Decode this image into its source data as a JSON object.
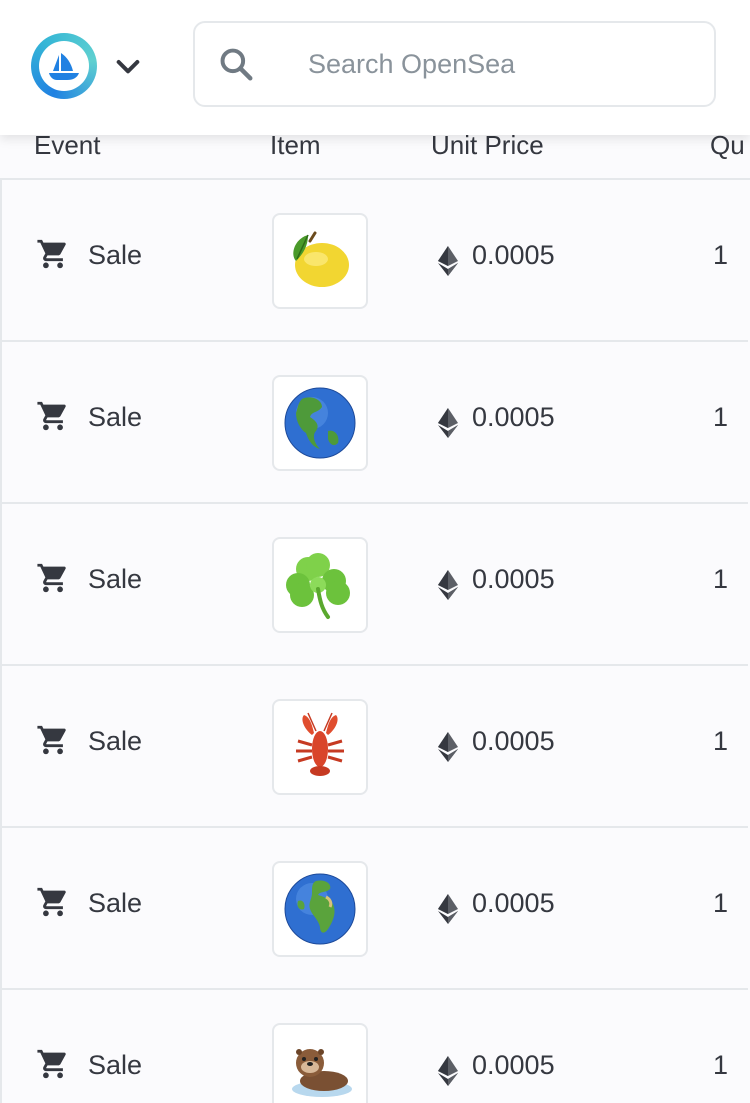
{
  "search": {
    "placeholder": "Search OpenSea"
  },
  "table": {
    "columns": [
      "Event",
      "Item",
      "Unit Price",
      "Qu"
    ],
    "rows": [
      {
        "event": "Sale",
        "item_icon": "lemon-icon",
        "price": "0.0005",
        "quantity": "1"
      },
      {
        "event": "Sale",
        "item_icon": "globe-americas-icon",
        "price": "0.0005",
        "quantity": "1"
      },
      {
        "event": "Sale",
        "item_icon": "shamrock-icon",
        "price": "0.0005",
        "quantity": "1"
      },
      {
        "event": "Sale",
        "item_icon": "lobster-icon",
        "price": "0.0005",
        "quantity": "1"
      },
      {
        "event": "Sale",
        "item_icon": "globe-europe-africa-icon",
        "price": "0.0005",
        "quantity": "1"
      },
      {
        "event": "Sale",
        "item_icon": "otter-icon",
        "price": "0.0005",
        "quantity": "1"
      }
    ]
  },
  "colors": {
    "brand": "#2081e2",
    "text": "#353840",
    "border": "#e5e8eb",
    "placeholder": "#8a939b"
  }
}
